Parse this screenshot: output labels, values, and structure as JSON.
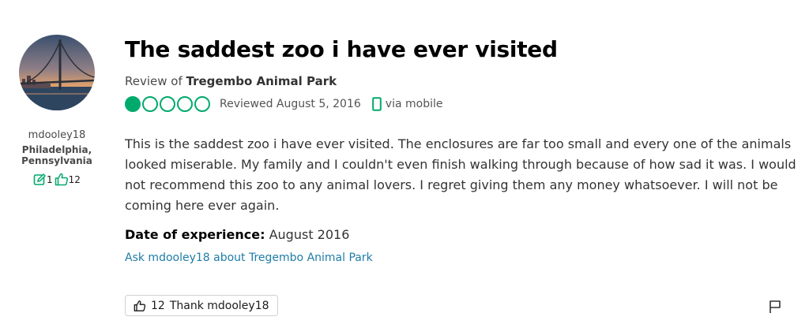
{
  "author": {
    "username": "mdooley18",
    "location": "Philadelphia, Pennsylvania",
    "contributions_count": "1",
    "helpful_votes_count": "12",
    "avatar_icon": "bridge-at-sunset-photo"
  },
  "review": {
    "title": "The saddest zoo i have ever visited",
    "subject_prefix": "Review of",
    "subject_name": "Tregembo Animal Park",
    "rating": 1,
    "rating_max": 5,
    "reviewed_date": "Reviewed August 5, 2016",
    "device": "via mobile",
    "body": "This is the saddest zoo i have ever visited. The enclosures are far too small and every one of the animals looked miserable. My family and I couldn't even finish walking through because of how sad it was. I would not recommend this zoo to any animal lovers. I regret giving them any money whatsoever. I will not be coming here ever again.",
    "experience_label": "Date of experience:",
    "experience_date": "August 2016",
    "ask_link": "Ask mdooley18 about Tregembo Animal Park"
  },
  "actions": {
    "thank_count": "12",
    "thank_label": "Thank mdooley18",
    "report_icon": "flag-icon"
  },
  "colors": {
    "bubble": "#00aa6c",
    "link": "#1f7ca8",
    "mobile_icon": "#00aa6c"
  }
}
